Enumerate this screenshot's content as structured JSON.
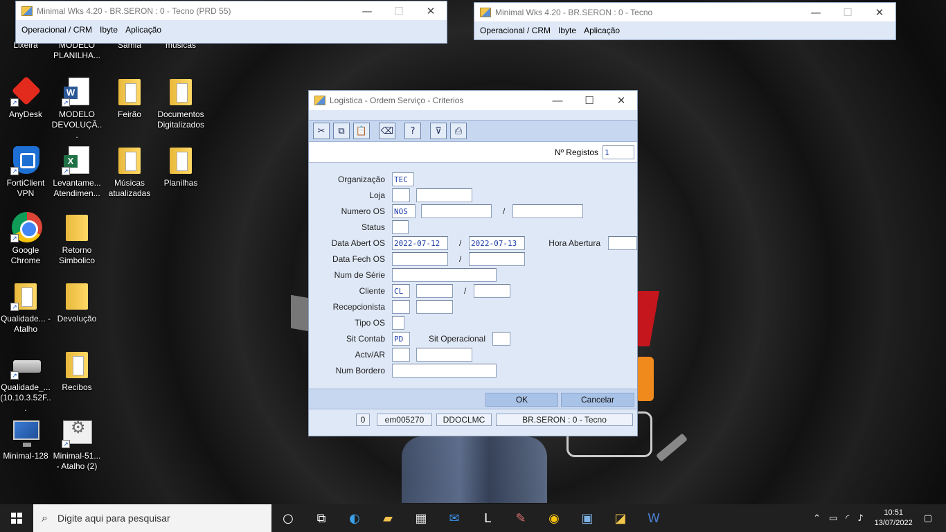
{
  "desktop_icons": [
    {
      "label": "Lixeira",
      "icon": "recycle-bin-icon"
    },
    {
      "label": "MODELO PLANILHA...",
      "icon": "excel-shortcut-icon"
    },
    {
      "label": "Samia",
      "icon": "folder-icon"
    },
    {
      "label": "musicas",
      "icon": "folder-icon"
    },
    {
      "label": "AnyDesk",
      "icon": "anydesk-icon"
    },
    {
      "label": "MODELO DEVOLUÇÃ...",
      "icon": "word-document-icon"
    },
    {
      "label": "Feirão",
      "icon": "folder-icon"
    },
    {
      "label": "Documentos Digitalizados",
      "icon": "folder-icon"
    },
    {
      "label": "FortiClient VPN",
      "icon": "forticlient-icon"
    },
    {
      "label": "Levantame... Atendimen...",
      "icon": "excel-document-icon"
    },
    {
      "label": "Músicas atualizadas",
      "icon": "folder-icon"
    },
    {
      "label": "Planilhas",
      "icon": "folder-icon"
    },
    {
      "label": "Google Chrome",
      "icon": "chrome-icon"
    },
    {
      "label": "Retorno Simbolico",
      "icon": "folder-icon"
    },
    {
      "label": "Qualidade... - Atalho",
      "icon": "folder-shortcut-icon"
    },
    {
      "label": "Devolução",
      "icon": "folder-icon"
    },
    {
      "label": "Qualidade_... (10.10.3.52F...",
      "icon": "network-drive-icon"
    },
    {
      "label": "Recibos",
      "icon": "folder-icon"
    },
    {
      "label": "Minimal-128",
      "icon": "remote-desktop-icon"
    },
    {
      "label": "Minimal-51... - Atalho (2)",
      "icon": "app-shortcut-icon"
    }
  ],
  "window1": {
    "title": "Minimal Wks 4.20 - BR.SERON : 0 - Tecno (PRD 55)",
    "menu": [
      "Operacional / CRM",
      "Ibyte",
      "Aplicação"
    ]
  },
  "window2": {
    "title": "Minimal Wks 4.20 - BR.SERON : 0 - Tecno",
    "menu": [
      "Operacional / CRM",
      "Ibyte",
      "Aplicação"
    ]
  },
  "dialog": {
    "title": "Logistica - Ordem Serviço - Criterios",
    "registos_label": "Nº Registos",
    "registos_value": "1",
    "fields": {
      "organizacao": {
        "label": "Organização",
        "value": "TEC"
      },
      "loja": {
        "label": "Loja",
        "value1": "",
        "value2": ""
      },
      "numero_os": {
        "label": "Numero OS",
        "value1": "NOS",
        "value2": "",
        "value3": ""
      },
      "status": {
        "label": "Status",
        "value": ""
      },
      "data_abert_os": {
        "label": "Data Abert OS",
        "from": "2022-07-12",
        "to": "2022-07-13"
      },
      "hora_abertura": {
        "label": "Hora Abertura",
        "value": ""
      },
      "data_fech_os": {
        "label": "Data Fech OS",
        "from": "",
        "to": ""
      },
      "num_serie": {
        "label": "Num de Série",
        "value": ""
      },
      "cliente": {
        "label": "Cliente",
        "value1": "CL",
        "value2": "",
        "value3": ""
      },
      "recepcionista": {
        "label": "Recepcionista",
        "value1": "",
        "value2": ""
      },
      "tipo_os": {
        "label": "Tipo OS",
        "value": ""
      },
      "sit_contab": {
        "label": "Sit Contab",
        "value": "PD"
      },
      "sit_operacional": {
        "label": "Sit Operacional",
        "value": ""
      },
      "actv_ar": {
        "label": "Actv/AR",
        "value1": "",
        "value2": ""
      },
      "num_bordero": {
        "label": "Num Bordero",
        "value": ""
      }
    },
    "slash": "/",
    "ok_label": "OK",
    "cancel_label": "Cancelar",
    "status": {
      "count": "0",
      "user": "em005270",
      "code": "DDOCLMC",
      "org": "BR.SERON : 0 - Tecno"
    }
  },
  "taskbar": {
    "search_placeholder": "Digite aqui para pesquisar",
    "time": "10:51",
    "date": "13/07/2022"
  }
}
